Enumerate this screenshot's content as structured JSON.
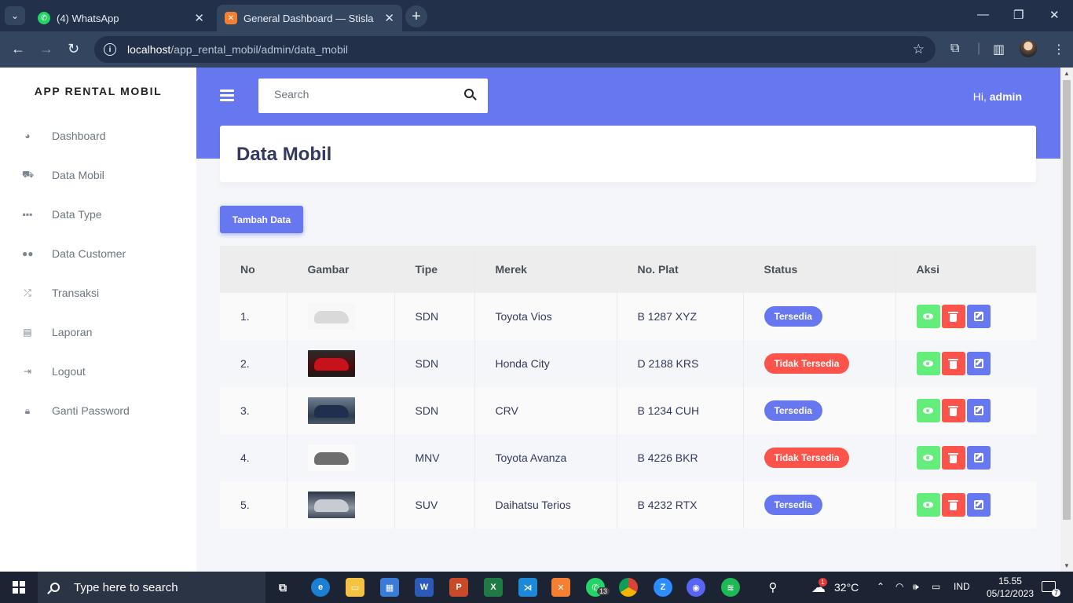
{
  "browser": {
    "tabs": [
      {
        "label": "(4) WhatsApp",
        "favicon": "whatsapp-icon"
      },
      {
        "label": "General Dashboard — Stisla",
        "favicon": "xampp-icon",
        "active": true
      }
    ],
    "url_host": "localhost",
    "url_path": "/app_rental_mobil/admin/data_mobil"
  },
  "sidebar": {
    "brand": "APP RENTAL MOBIL",
    "items": [
      {
        "label": "Dashboard",
        "icon": "tachometer-icon"
      },
      {
        "label": "Data Mobil",
        "icon": "car-icon"
      },
      {
        "label": "Data Type",
        "icon": "grid-icon"
      },
      {
        "label": "Data Customer",
        "icon": "users-icon"
      },
      {
        "label": "Transaksi",
        "icon": "random-icon"
      },
      {
        "label": "Laporan",
        "icon": "clipboard-icon"
      },
      {
        "label": "Logout",
        "icon": "sign-out-icon"
      },
      {
        "label": "Ganti Password",
        "icon": "lock-icon"
      }
    ]
  },
  "navbar": {
    "search_placeholder": "Search",
    "greeting": "Hi,",
    "user": "admin"
  },
  "main": {
    "title": "Data Mobil",
    "add_button": "Tambah Data",
    "columns": [
      "No",
      "Gambar",
      "Tipe",
      "Merek",
      "No. Plat",
      "Status",
      "Aksi"
    ],
    "rows": [
      {
        "no": "1.",
        "tipe": "SDN",
        "merek": "Toyota Vios",
        "plat": "B 1287 XYZ",
        "status": "Tersedia",
        "available": true,
        "image": "white-sedan"
      },
      {
        "no": "2.",
        "tipe": "SDN",
        "merek": "Honda City",
        "plat": "D 2188 KRS",
        "status": "Tidak Tersedia",
        "available": false,
        "image": "red-sedan"
      },
      {
        "no": "3.",
        "tipe": "SDN",
        "merek": "CRV",
        "plat": "B 1234 CUH",
        "status": "Tersedia",
        "available": true,
        "image": "dark-suv"
      },
      {
        "no": "4.",
        "tipe": "MNV",
        "merek": "Toyota Avanza",
        "plat": "B 4226 BKR",
        "status": "Tidak Tersedia",
        "available": false,
        "image": "grey-mpv"
      },
      {
        "no": "5.",
        "tipe": "SUV",
        "merek": "Daihatsu Terios",
        "plat": "B 4232 RTX",
        "status": "Tersedia",
        "available": true,
        "image": "silver-suv"
      }
    ]
  },
  "taskbar": {
    "search_text": "Type here to search",
    "temperature": "32°C",
    "language": "IND",
    "time": "15.55",
    "date": "05/12/2023",
    "whatsapp_badge": "13",
    "weather_badge": "1",
    "notification_count": "7"
  },
  "colors": {
    "primary": "#6777ef",
    "success": "#63ed7a",
    "danger": "#fc544b"
  }
}
